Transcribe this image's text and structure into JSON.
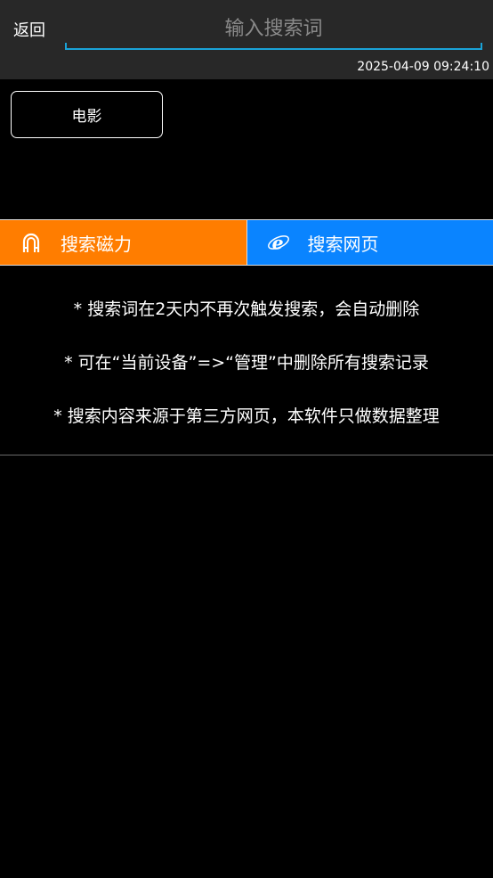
{
  "header": {
    "back_label": "返回",
    "search_placeholder": "输入搜索词",
    "datetime": "2025-04-09 09:24:10"
  },
  "chips": [
    {
      "label": "电影"
    }
  ],
  "actions": {
    "magnet": {
      "label": "搜索磁力",
      "icon": "magnet-icon",
      "color": "#ff7d00"
    },
    "web": {
      "label": "搜索网页",
      "icon": "ie-browser-icon",
      "color": "#0a84ff"
    }
  },
  "notes": [
    "* 搜索词在2天内不再次触发搜索，会自动删除",
    "* 可在“当前设备”=>“管理”中删除所有搜索记录",
    "* 搜索内容来源于第三方网页，本软件只做数据整理"
  ],
  "colors": {
    "accent": "#1aa3d8",
    "topbar_bg": "#282828"
  }
}
